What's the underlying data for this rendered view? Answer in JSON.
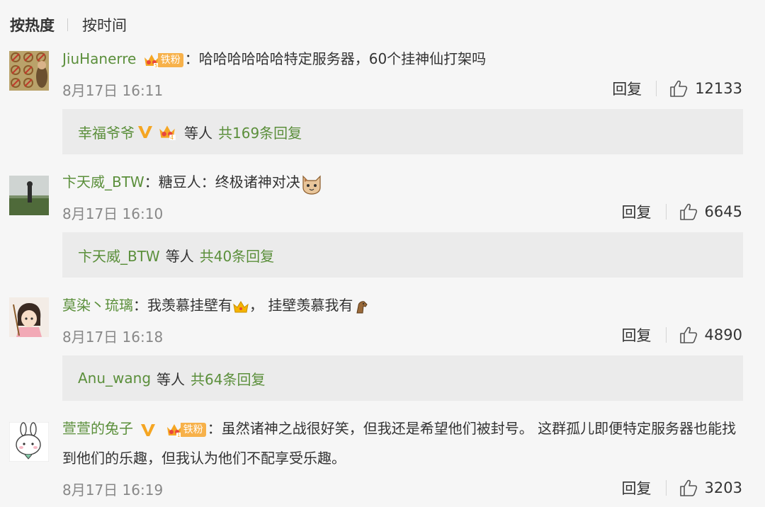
{
  "sort": {
    "hot": "按热度",
    "time": "按时间"
  },
  "colors": {
    "username": "#5b8f3b",
    "fan_tag": "#f7b14a",
    "vip_v": "#f5a623",
    "subbox_bg": "#ebebeb",
    "page_bg": "#f6f6f6"
  },
  "labels": {
    "reply": "回复",
    "colon": "：",
    "deng": "等人"
  },
  "comments": [
    {
      "user": "JiuHanerre",
      "fan_tag": "铁粉",
      "text": "哈哈哈哈哈哈特定服务器，60个挂神仙打架吗",
      "time": "8月17日 16:11",
      "likes": "12133",
      "sub_user": "幸福爷爷",
      "sub_total": "共169条回复"
    },
    {
      "user": "卞天威_BTW",
      "text": "糖豆人：终极诸神对决",
      "emoji": "cat-face-emoji",
      "time": "8月17日 16:10",
      "likes": "6645",
      "sub_user": "卞天威_BTW",
      "sub_total": "共40条回复"
    },
    {
      "user": "莫染丶琉璃",
      "text_a": "我羡慕挂壁有",
      "text_b": "，  挂壁羡慕我有",
      "emoji_a": "crown-emoji",
      "emoji_b": "horse-emoji",
      "time": "8月17日 16:18",
      "likes": "4890",
      "sub_user": "Anu_wang",
      "sub_total": "共64条回复"
    },
    {
      "user": "萱萱的兔子",
      "fan_tag": "铁粉",
      "text": "虽然诸神之战很好笑，但我还是希望他们被封号。 这群孤儿即便特定服务器也能找到他们的乐趣，但我认为他们不配享受乐趣。",
      "time": "8月17日 16:19",
      "likes": "3203"
    }
  ]
}
